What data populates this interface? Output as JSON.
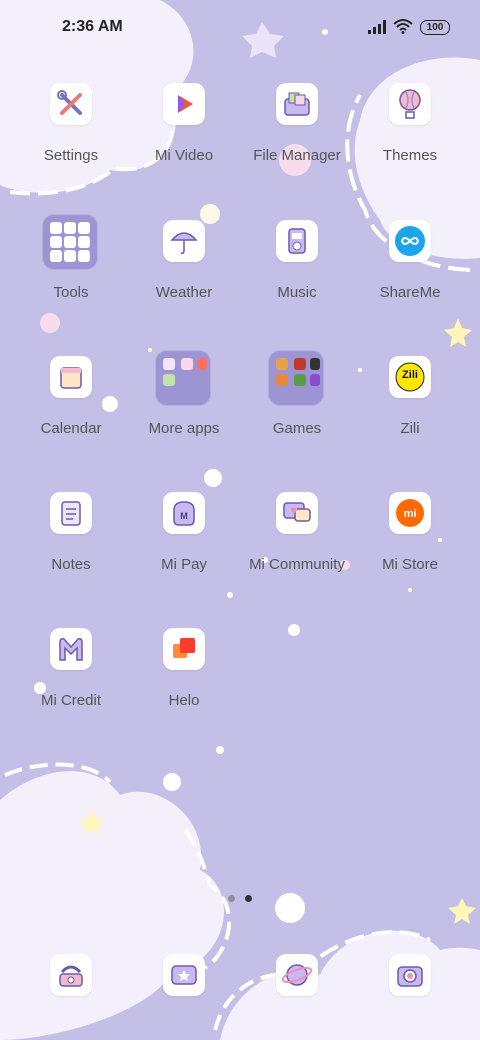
{
  "status_bar": {
    "time": "2:36 AM",
    "battery": "100"
  },
  "apps": {
    "settings": "Settings",
    "mi_video": "Mi Video",
    "file_manager": "File Manager",
    "themes": "Themes",
    "tools": "Tools",
    "weather": "Weather",
    "music": "Music",
    "shareme": "ShareMe",
    "calendar": "Calendar",
    "more_apps": "More apps",
    "games": "Games",
    "zili": "Zili",
    "notes": "Notes",
    "mi_pay": "Mi Pay",
    "mi_community": "Mi Community",
    "mi_store": "Mi Store",
    "mi_credit": "Mi Credit",
    "helo": "Helo"
  },
  "icon_text": {
    "zili": "Zili",
    "mi_store": "mi"
  },
  "page_indicator": {
    "total": 2,
    "current": 2
  },
  "dock": [
    "phone-icon",
    "messages-icon",
    "browser-planet-icon",
    "camera-icon"
  ],
  "colors": {
    "wallpaper": "#c4bfe6",
    "cloud": "#f3effb",
    "folder": "#9d95d3",
    "label": "#555555"
  }
}
